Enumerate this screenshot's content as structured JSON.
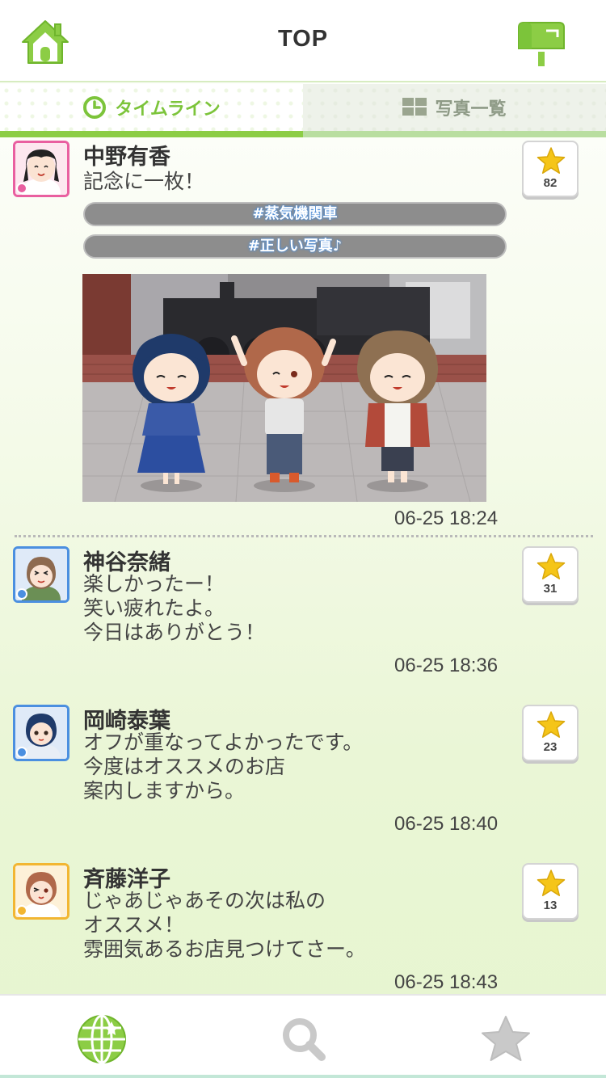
{
  "header": {
    "title": "TOP",
    "home_icon": "home-icon",
    "mail_icon": "mailbox-icon",
    "accent_color": "#8ccd45"
  },
  "tabs": [
    {
      "label": "タイムライン",
      "icon": "clock-icon",
      "active": true
    },
    {
      "label": "写真一覧",
      "icon": "grid-icon",
      "active": false
    }
  ],
  "posts": [
    {
      "name": "中野有香",
      "avatar_type": "cute",
      "message": "記念に一枚！",
      "tags": [
        "#蒸気機関車",
        "#正しい写真♪"
      ],
      "has_photo": true,
      "likes": "82",
      "timestamp": "06-25 18:24"
    },
    {
      "name": "神谷奈緒",
      "avatar_type": "cool",
      "message": "楽しかったー！\n笑い疲れたよ。\n今日はありがとう！",
      "tags": [],
      "has_photo": false,
      "likes": "31",
      "timestamp": "06-25 18:36"
    },
    {
      "name": "岡崎泰葉",
      "avatar_type": "cool",
      "message": "オフが重なってよかったです。\n今度はオススメのお店\n案内しますから。",
      "tags": [],
      "has_photo": false,
      "likes": "23",
      "timestamp": "06-25 18:40"
    },
    {
      "name": "斉藤洋子",
      "avatar_type": "passion",
      "message": "じゃあじゃあその次は私の\nオススメ！\n雰囲気あるお店見つけてさー。",
      "tags": [],
      "has_photo": false,
      "likes": "13",
      "timestamp": "06-25 18:43"
    }
  ],
  "bottom_nav": [
    {
      "icon": "globe-icon",
      "active": true
    },
    {
      "icon": "search-icon",
      "active": false
    },
    {
      "icon": "star-icon",
      "active": false
    }
  ]
}
